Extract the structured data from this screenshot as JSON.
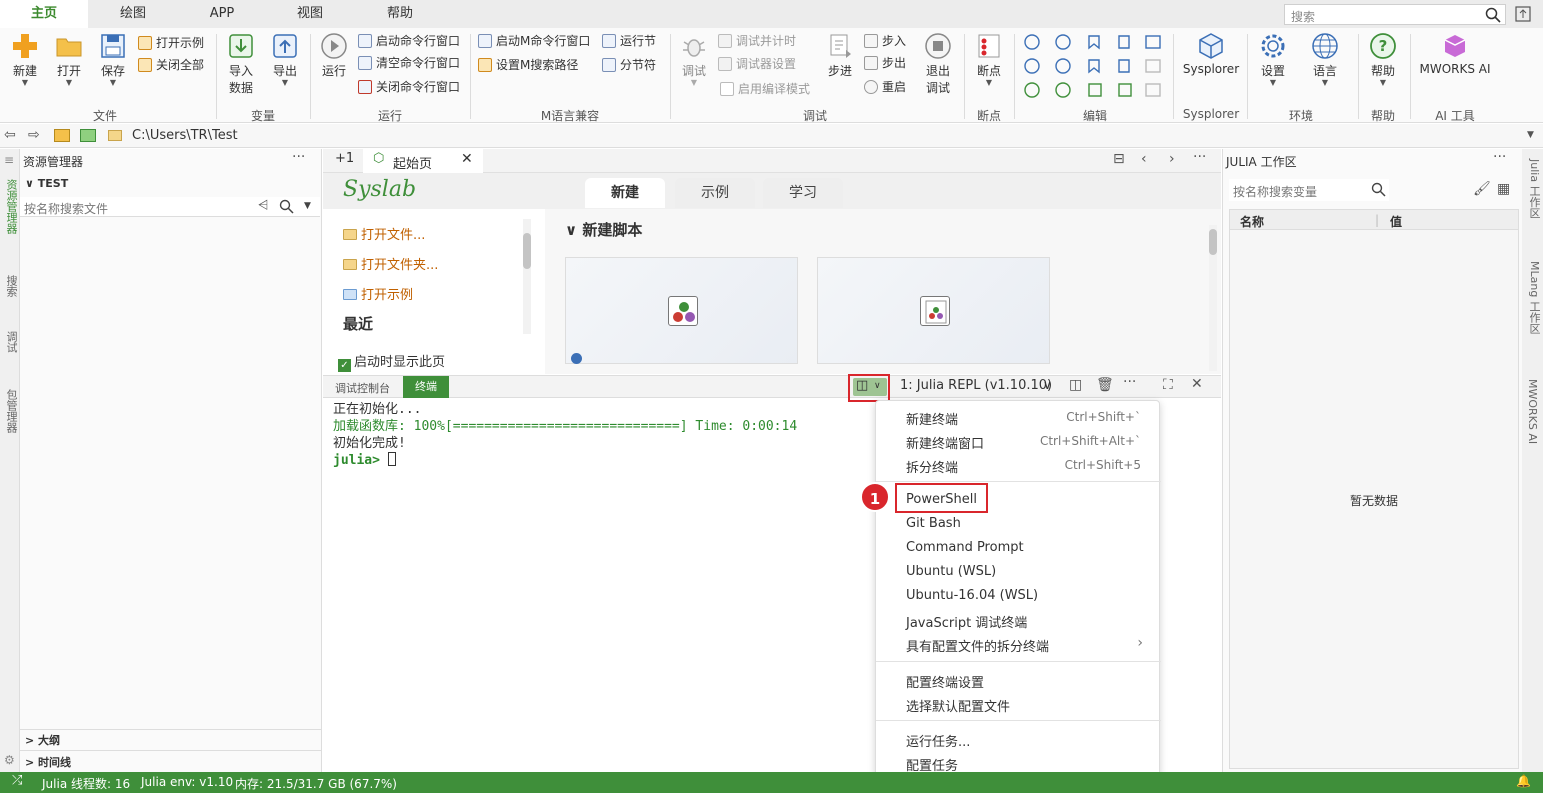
{
  "menubar": {
    "tabs": [
      "主页",
      "绘图",
      "APP",
      "视图",
      "帮助"
    ],
    "active_tab": "主页",
    "search_placeholder": "搜索"
  },
  "ribbon": {
    "file": {
      "new": "新建",
      "open": "打开",
      "save": "保存",
      "open_examples": "打开示例",
      "close_all": "关闭全部",
      "group": "文件"
    },
    "variables": {
      "import": "导入\n数据",
      "import_l1": "导入",
      "import_l2": "数据",
      "export": "导出",
      "group": "变量"
    },
    "run": {
      "run": "运行",
      "start_cmd": "启动命令行窗口",
      "clear_cmd": "清空命令行窗口",
      "close_cmd": "关闭命令行窗口",
      "group": "运行"
    },
    "m_lang": {
      "start_m": "启动M命令行窗口",
      "set_path": "设置M搜索路径",
      "run_section": "运行节",
      "section_sep": "分节符",
      "group": "M语言兼容"
    },
    "debug": {
      "debug": "调试",
      "debug_timer": "调试并计时",
      "debugger_settings": "调试器设置",
      "compile_mode": "启用编译模式",
      "step": "步进",
      "step_in": "步入",
      "step_out": "步出",
      "restart": "重启",
      "exit_debug_l1": "退出",
      "exit_debug_l2": "调试",
      "group": "调试"
    },
    "breakpoints": {
      "label": "断点",
      "group": "断点"
    },
    "edit": {
      "group": "编辑"
    },
    "sysplorer": {
      "label": "Sysplorer",
      "group": "Sysplorer"
    },
    "env": {
      "settings": "设置",
      "language": "语言",
      "group": "环境"
    },
    "help": {
      "label": "帮助",
      "group": "帮助"
    },
    "ai": {
      "label": "MWORKS AI",
      "group": "AI 工具"
    }
  },
  "address": {
    "path": "C:\\Users\\TR\\Test"
  },
  "explorer": {
    "title": "资源管理器",
    "folder": "TEST",
    "search_placeholder": "按名称搜索文件",
    "outline": "大纲",
    "timeline": "时间线"
  },
  "left_strip": [
    "资源管理器",
    "搜索",
    "调试",
    "包管理器"
  ],
  "editor": {
    "tab_plus": "+1",
    "start_tab": "起始页",
    "logo": "Syslab",
    "tabs": [
      "新建",
      "示例",
      "学习"
    ],
    "active_tab": "新建",
    "links": [
      "打开文件...",
      "打开文件夹...",
      "打开示例"
    ],
    "recent": "最近",
    "show_on_start": "启动时显示此页",
    "new_script": "新建脚本"
  },
  "panel": {
    "tabs": [
      "调试控制台",
      "终端"
    ],
    "active_tab": "终端",
    "terminal_select": "1: Julia REPL (v1.10.10)",
    "lines": [
      {
        "text": "正在初始化...",
        "color": "#333333"
      },
      {
        "text": "加载函数库: 100%[=============================] Time: 0:00:14",
        "color": "#2e8b2e"
      },
      {
        "text": "初始化完成!",
        "color": "#333333"
      }
    ],
    "prompt": "julia>"
  },
  "dropdown": {
    "items_top": [
      {
        "label": "新建终端",
        "key": "Ctrl+Shift+`"
      },
      {
        "label": "新建终端窗口",
        "key": "Ctrl+Shift+Alt+`"
      },
      {
        "label": "拆分终端",
        "key": "Ctrl+Shift+5"
      }
    ],
    "profiles": [
      "PowerShell",
      "Git Bash",
      "Command Prompt",
      "Ubuntu (WSL)",
      "Ubuntu-16.04 (WSL)",
      "JavaScript 调试终端",
      "具有配置文件的拆分终端"
    ],
    "settings": [
      "配置终端设置",
      "选择默认配置文件"
    ],
    "tasks": [
      "运行任务...",
      "配置任务"
    ],
    "callout_number": "1"
  },
  "julia_workspace": {
    "title": "JULIA 工作区",
    "search_placeholder": "按名称搜索变量",
    "col_name": "名称",
    "col_value": "值",
    "empty": "暂无数据"
  },
  "right_strip": [
    "Julia 工作区",
    "MLang 工作区",
    "MWORKS AI"
  ],
  "status": {
    "threads": "Julia 线程数: 16",
    "env": "Julia env: v1.10",
    "memory": "内存: 21.5/31.7 GB (67.7%)"
  },
  "colors": {
    "accent": "#3f8f3a",
    "highlight": "#d9262c"
  }
}
